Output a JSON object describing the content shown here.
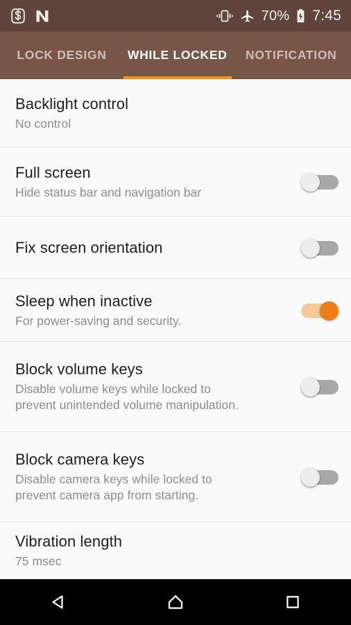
{
  "status_bar": {
    "background_color": "#5E443A",
    "left_icons": [
      {
        "name": "app-s-logo-icon",
        "label": "S"
      },
      {
        "name": "nova-n-logo-icon",
        "label": "N"
      }
    ],
    "right_icons": [
      {
        "name": "vibrate-icon"
      },
      {
        "name": "airplane-mode-icon"
      },
      {
        "name": "battery-charging-icon"
      }
    ],
    "battery_percent": "70%",
    "time": "7:45"
  },
  "tabs": {
    "active_index": 1,
    "accent_color": "#F59121",
    "background_color": "#795548",
    "items": [
      {
        "label": "LOCK DESIGN"
      },
      {
        "label": "WHILE LOCKED"
      },
      {
        "label": "NOTIFICATION"
      }
    ]
  },
  "settings": {
    "rows": [
      {
        "title": "Backlight control",
        "subtitle": "No control",
        "subtitle_line2": "",
        "has_switch": false,
        "switch_on": false
      },
      {
        "title": "Full screen",
        "subtitle": "Hide status bar and navigation bar",
        "subtitle_line2": "",
        "has_switch": true,
        "switch_on": false
      },
      {
        "title": "Fix screen orientation",
        "subtitle": "",
        "subtitle_line2": "",
        "has_switch": true,
        "switch_on": false
      },
      {
        "title": "Sleep when inactive",
        "subtitle": "For power-saving and security.",
        "subtitle_line2": "",
        "has_switch": true,
        "switch_on": true
      },
      {
        "title": "Block volume keys",
        "subtitle": "Disable volume keys while locked to",
        "subtitle_line2": "prevent unintended volume manipulation.",
        "has_switch": true,
        "switch_on": false
      },
      {
        "title": "Block camera keys",
        "subtitle": "Disable camera keys while locked to",
        "subtitle_line2": "prevent camera app from starting.",
        "has_switch": true,
        "switch_on": false
      },
      {
        "title": "Vibration length",
        "subtitle": "75 msec",
        "subtitle_line2": "",
        "has_switch": false,
        "switch_on": false
      }
    ]
  },
  "navigation_bar": {
    "buttons": [
      {
        "name": "back-button"
      },
      {
        "name": "home-button"
      },
      {
        "name": "recents-button"
      }
    ]
  }
}
